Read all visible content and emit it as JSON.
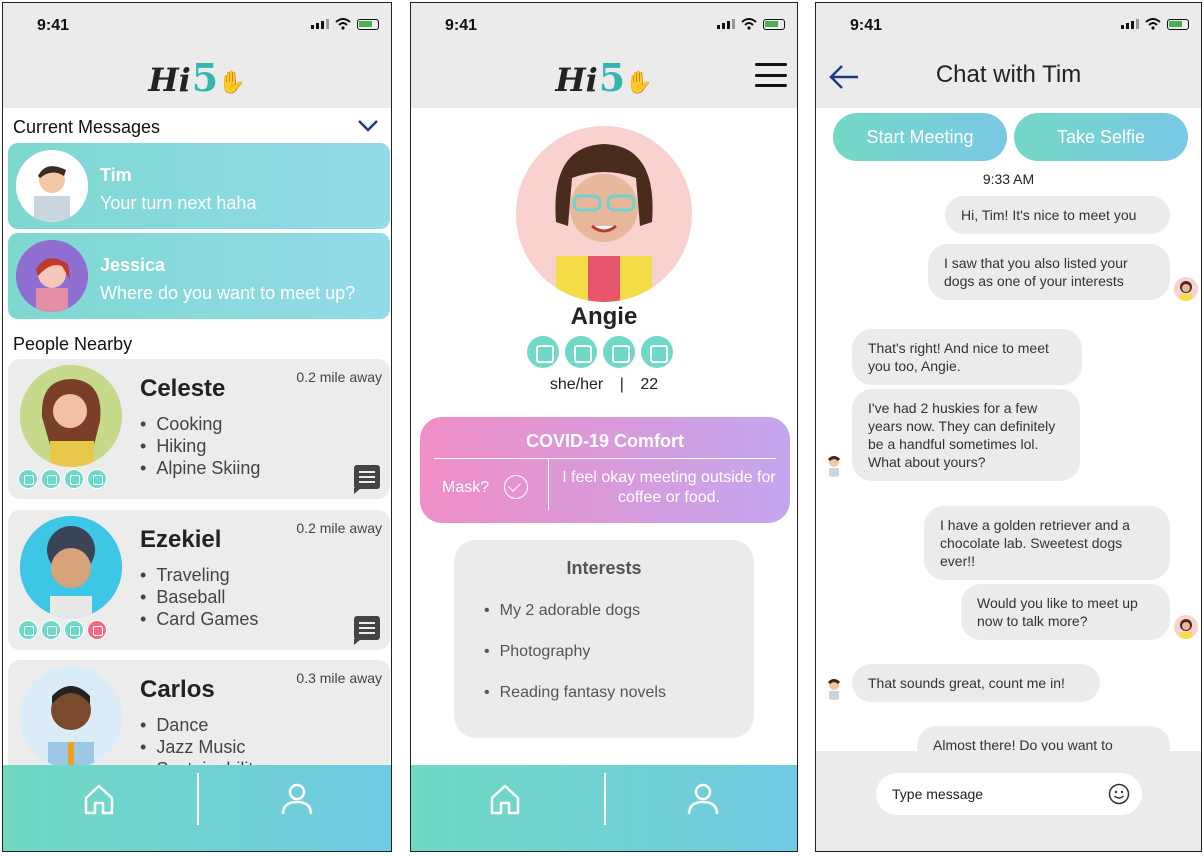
{
  "status": {
    "time": "9:41"
  },
  "screen1": {
    "logo": {
      "text": "Hi",
      "number": "5"
    },
    "current_messages_title": "Current Messages",
    "messages": [
      {
        "name": "Tim",
        "text": "Your turn next haha"
      },
      {
        "name": "Jessica",
        "text": "Where do you want to meet up?"
      }
    ],
    "people_nearby_title": "People Nearby",
    "people": [
      {
        "name": "Celeste",
        "distance": "0.2 mile away",
        "interests": [
          "Cooking",
          "Hiking",
          "Alpine Skiing"
        ]
      },
      {
        "name": "Ezekiel",
        "distance": "0.2 mile away",
        "interests": [
          "Traveling",
          "Baseball",
          "Card Games"
        ]
      },
      {
        "name": "Carlos",
        "distance": "0.3 mile away",
        "interests": [
          "Dance",
          "Jazz Music",
          "Sustainability"
        ]
      }
    ]
  },
  "screen2": {
    "logo": {
      "text": "Hi",
      "number": "5"
    },
    "name": "Angie",
    "pronouns": "she/her",
    "age": "22",
    "covid": {
      "title": "COVID-19 Comfort",
      "mask_label": "Mask?",
      "note": "I feel okay meeting outside for coffee or food."
    },
    "interests": {
      "title": "Interests",
      "items": [
        "My 2 adorable dogs",
        "Photography",
        "Reading fantasy novels"
      ]
    }
  },
  "screen3": {
    "title": "Chat with Tim",
    "start_meeting": "Start Meeting",
    "take_selfie": "Take Selfie",
    "timestamp": "9:33 AM",
    "messages": [
      {
        "text": "Hi, Tim! It's nice to meet you",
        "from": "me"
      },
      {
        "text": "I saw that you also listed your dogs as one of your interests",
        "from": "me"
      },
      {
        "text": "That's right! And nice to meet you too, Angie.",
        "from": "them"
      },
      {
        "text": "I've had 2 huskies for a few years now. They can definitely be a handful sometimes lol. What about yours?",
        "from": "them"
      },
      {
        "text": "I have a golden retriever and a chocolate lab. Sweetest dogs ever!!",
        "from": "me"
      },
      {
        "text": "Would you like to meet up now to talk more?",
        "from": "me"
      },
      {
        "text": "That sounds great, count me in!",
        "from": "them"
      },
      {
        "text": "Almost there! Do you want to",
        "from": "me"
      }
    ],
    "composer_placeholder": "Type message"
  }
}
